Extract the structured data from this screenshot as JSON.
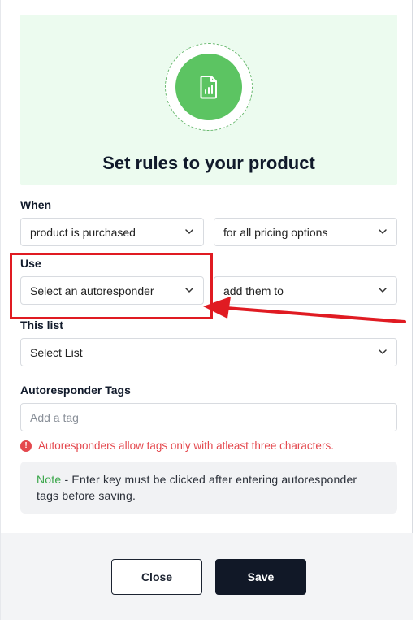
{
  "hero": {
    "title": "Set rules to your product",
    "icon": "chart-document-icon"
  },
  "when": {
    "label": "When",
    "trigger_select": "product is purchased",
    "pricing_select": "for all pricing options"
  },
  "use": {
    "label": "Use",
    "autoresponder_select": "Select an autoresponder",
    "action_select": "add them to"
  },
  "list": {
    "label": "This list",
    "list_select": "Select List"
  },
  "tags": {
    "label": "Autoresponder Tags",
    "placeholder": "Add a tag",
    "error_icon": "!",
    "error": "Autoresponders allow tags only with atleast three characters."
  },
  "note": {
    "keyword": "Note",
    "text": " - Enter key must be clicked after entering autoresponder tags before saving."
  },
  "footer": {
    "close_label": "Close",
    "save_label": "Save"
  },
  "colors": {
    "accent_green": "#5cc462",
    "hero_bg": "#ecfbef",
    "error_red": "#e4484e",
    "annotation_red": "#e01b22",
    "save_bg": "#111827"
  }
}
